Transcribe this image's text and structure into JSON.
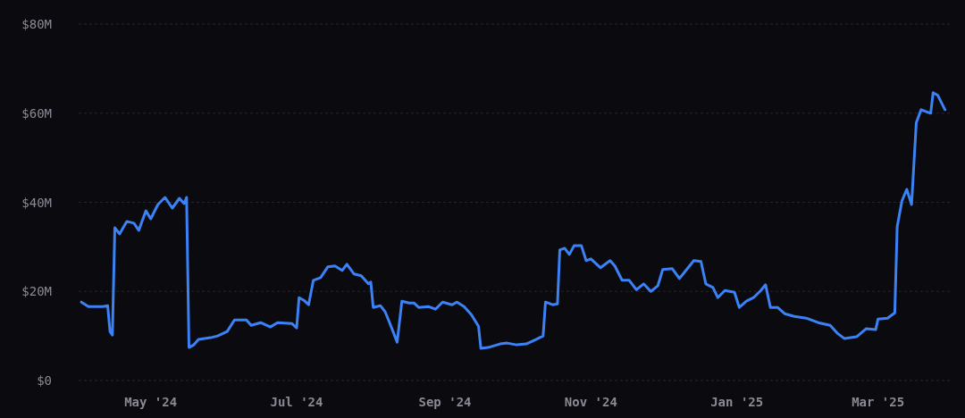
{
  "chart": {
    "chart_data": {
      "type": "line",
      "ylim": [
        0,
        80
      ],
      "xlim": [
        "2024-04-02",
        "2025-03-31"
      ],
      "grid": true,
      "yticks": [
        {
          "value": 0,
          "label": "$0"
        },
        {
          "value": 20,
          "label": "$20M"
        },
        {
          "value": 40,
          "label": "$40M"
        },
        {
          "value": 60,
          "label": "$60M"
        },
        {
          "value": 80,
          "label": "$80M"
        }
      ],
      "xticks": [
        {
          "value": "2024-05-01",
          "label": "May '24"
        },
        {
          "value": "2024-07-01",
          "label": "Jul '24"
        },
        {
          "value": "2024-09-01",
          "label": "Sep '24"
        },
        {
          "value": "2024-11-01",
          "label": "Nov '24"
        },
        {
          "value": "2025-01-01",
          "label": "Jan '25"
        },
        {
          "value": "2025-03-01",
          "label": "Mar '25"
        }
      ],
      "x": [
        "2024-04-02",
        "2024-04-05",
        "2024-04-11",
        "2024-04-13",
        "2024-04-14",
        "2024-04-15",
        "2024-04-16",
        "2024-04-18",
        "2024-04-21",
        "2024-04-24",
        "2024-04-26",
        "2024-04-29",
        "2024-05-01",
        "2024-05-04",
        "2024-05-07",
        "2024-05-10",
        "2024-05-13",
        "2024-05-15",
        "2024-05-16",
        "2024-05-17",
        "2024-05-19",
        "2024-05-21",
        "2024-05-26",
        "2024-05-29",
        "2024-06-02",
        "2024-06-05",
        "2024-06-10",
        "2024-06-12",
        "2024-06-16",
        "2024-06-20",
        "2024-06-23",
        "2024-06-29",
        "2024-07-01",
        "2024-07-02",
        "2024-07-04",
        "2024-07-06",
        "2024-07-08",
        "2024-07-11",
        "2024-07-14",
        "2024-07-17",
        "2024-07-20",
        "2024-07-22",
        "2024-07-25",
        "2024-07-28",
        "2024-07-31",
        "2024-08-01",
        "2024-08-02",
        "2024-08-05",
        "2024-08-07",
        "2024-08-09",
        "2024-08-12",
        "2024-08-14",
        "2024-08-17",
        "2024-08-19",
        "2024-08-21",
        "2024-08-25",
        "2024-08-28",
        "2024-08-31",
        "2024-09-04",
        "2024-09-06",
        "2024-09-09",
        "2024-09-12",
        "2024-09-15",
        "2024-09-16",
        "2024-09-19",
        "2024-09-24",
        "2024-09-27",
        "2024-10-01",
        "2024-10-05",
        "2024-10-09",
        "2024-10-12",
        "2024-10-13",
        "2024-10-16",
        "2024-10-18",
        "2024-10-19",
        "2024-10-21",
        "2024-10-23",
        "2024-10-25",
        "2024-10-28",
        "2024-10-30",
        "2024-11-01",
        "2024-11-05",
        "2024-11-07",
        "2024-11-09",
        "2024-11-11",
        "2024-11-14",
        "2024-11-17",
        "2024-11-20",
        "2024-11-23",
        "2024-11-26",
        "2024-11-29",
        "2024-12-01",
        "2024-12-05",
        "2024-12-08",
        "2024-12-11",
        "2024-12-14",
        "2024-12-17",
        "2024-12-19",
        "2024-12-22",
        "2024-12-24",
        "2024-12-27",
        "2024-12-31",
        "2025-01-02",
        "2025-01-05",
        "2025-01-08",
        "2025-01-11",
        "2025-01-13",
        "2025-01-15",
        "2025-01-18",
        "2025-01-21",
        "2025-01-25",
        "2025-01-30",
        "2025-02-04",
        "2025-02-09",
        "2025-02-12",
        "2025-02-15",
        "2025-02-20",
        "2025-02-24",
        "2025-02-28",
        "2025-03-01",
        "2025-03-05",
        "2025-03-08",
        "2025-03-09",
        "2025-03-11",
        "2025-03-13",
        "2025-03-15",
        "2025-03-17",
        "2025-03-19",
        "2025-03-23",
        "2025-03-24",
        "2025-03-26",
        "2025-03-29"
      ],
      "series": [
        {
          "color": "#3b82f6",
          "values": [
            17.6,
            16.6,
            16.6,
            16.8,
            11.0,
            10.2,
            34.3,
            32.9,
            35.7,
            35.3,
            33.7,
            38.1,
            36.3,
            39.5,
            41.1,
            38.7,
            40.9,
            39.7,
            41.1,
            7.4,
            8.0,
            9.2,
            9.6,
            10.0,
            11.0,
            13.6,
            13.6,
            12.4,
            13.0,
            12.0,
            13.0,
            12.8,
            11.8,
            18.6,
            18.0,
            17.0,
            22.5,
            23.1,
            25.5,
            25.7,
            24.7,
            26.1,
            23.9,
            23.5,
            21.7,
            22.1,
            16.4,
            16.8,
            15.4,
            12.8,
            8.6,
            17.8,
            17.4,
            17.4,
            16.4,
            16.6,
            16.0,
            17.6,
            17.0,
            17.6,
            16.6,
            14.8,
            12.2,
            7.2,
            7.4,
            8.2,
            8.4,
            8.0,
            8.2,
            9.2,
            10.0,
            17.6,
            17.0,
            17.2,
            29.3,
            29.7,
            28.3,
            30.3,
            30.3,
            26.9,
            27.3,
            25.3,
            26.1,
            26.9,
            25.7,
            22.5,
            22.5,
            20.4,
            21.7,
            20.0,
            21.3,
            24.9,
            25.1,
            22.9,
            24.9,
            26.9,
            26.7,
            21.7,
            20.9,
            18.6,
            20.2,
            19.8,
            16.4,
            17.8,
            18.6,
            20.2,
            21.5,
            16.4,
            16.4,
            15.0,
            14.4,
            14.0,
            13.0,
            12.4,
            10.6,
            9.4,
            9.8,
            11.6,
            11.4,
            13.8,
            14.0,
            15.2,
            34.5,
            40.3,
            42.9,
            39.5,
            57.9,
            60.8,
            60.0,
            64.6,
            64.0,
            60.8
          ]
        }
      ]
    }
  }
}
